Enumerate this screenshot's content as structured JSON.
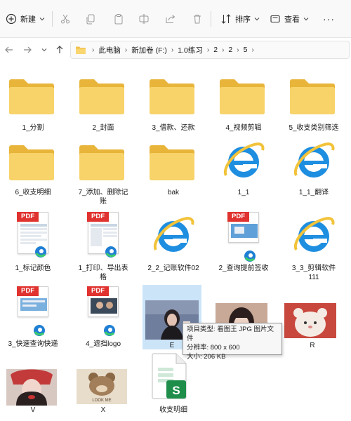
{
  "toolbar": {
    "new_label": "新建",
    "sort_label": "排序",
    "view_label": "查看",
    "more_label": "···"
  },
  "breadcrumb": [
    "此电脑",
    "新加卷 (F:)",
    "1.0练习",
    "2",
    "2",
    "5"
  ],
  "items": [
    {
      "label": "1_分割",
      "type": "folder"
    },
    {
      "label": "2_封面",
      "type": "folder"
    },
    {
      "label": "3_借款、还款",
      "type": "folder"
    },
    {
      "label": "4_视频剪辑",
      "type": "folder"
    },
    {
      "label": "5_收支类别筛选",
      "type": "folder"
    },
    {
      "label": "6_收支明细",
      "type": "folder"
    },
    {
      "label": "7_添加、删除记账",
      "type": "folder"
    },
    {
      "label": "bak",
      "type": "folder"
    },
    {
      "label": "1_1",
      "type": "ie-shortcut"
    },
    {
      "label": "1_1_翻译",
      "type": "ie-shortcut"
    },
    {
      "label": "1_标记颜色",
      "type": "pdf"
    },
    {
      "label": "1_打印、导出表格",
      "type": "pdf"
    },
    {
      "label": "2_2_记账软件02",
      "type": "ie-shortcut"
    },
    {
      "label": "2_查询提前签收",
      "type": "pdf"
    },
    {
      "label": "3_3_剪辑软件111",
      "type": "ie-shortcut"
    },
    {
      "label": "3_快速查询快递",
      "type": "pdf"
    },
    {
      "label": "4_遮挡logo",
      "type": "pdf"
    },
    {
      "label": "E",
      "type": "image"
    },
    {
      "label": "",
      "type": "image"
    },
    {
      "label": "R",
      "type": "image"
    },
    {
      "label": "V",
      "type": "image"
    },
    {
      "label": "X",
      "type": "image"
    },
    {
      "label": "收支明细",
      "type": "spreadsheet"
    }
  ],
  "tooltip": {
    "line1": "项目类型: 看图王 JPG 图片文件",
    "line2": "分辨率: 800 x 600",
    "line3": "大小: 206 KB"
  },
  "colors": {
    "folder_back": "#e8b53a",
    "folder_front": "#f8d36a",
    "ie_blue": "#1e8ee0",
    "ie_ring": "#f2c33a",
    "pdf_red": "#e0332f",
    "selection": "#cce4f7",
    "sheet_green": "#1e8e4a"
  },
  "thumb_texts": {
    "x_caption": "LOOK ME"
  }
}
